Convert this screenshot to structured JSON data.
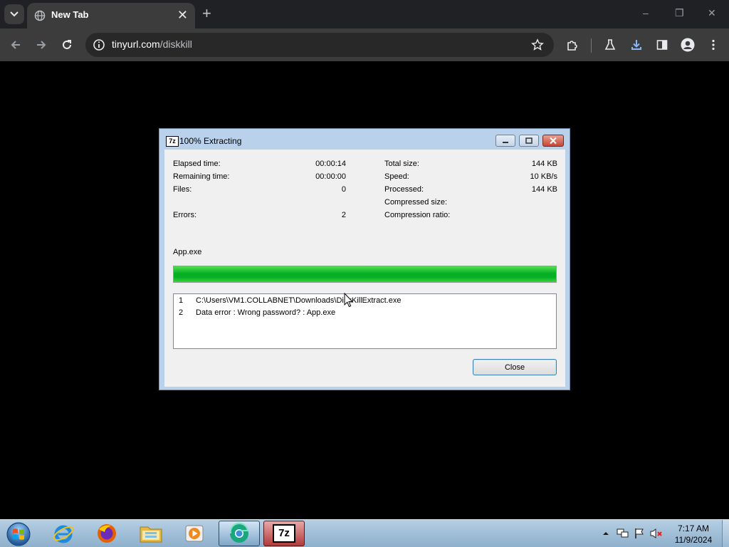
{
  "browser": {
    "tab_title": "New Tab",
    "url_domain": "tinyurl.com",
    "url_path": "/diskkill",
    "tab_close_glyph": "✕",
    "new_tab_glyph": "+",
    "window_controls": [
      "–",
      "❐",
      "✕"
    ]
  },
  "dialog": {
    "title": "100% Extracting",
    "title_icon_text": "7z",
    "stats_left": [
      {
        "label": "Elapsed time:",
        "value": "00:00:14"
      },
      {
        "label": "Remaining time:",
        "value": "00:00:00"
      },
      {
        "label": "Files:",
        "value": "0"
      },
      {
        "label": "Errors:",
        "value": "2"
      }
    ],
    "stats_right": [
      {
        "label": "Total size:",
        "value": "144 KB"
      },
      {
        "label": "Speed:",
        "value": "10 KB/s"
      },
      {
        "label": "Processed:",
        "value": "144 KB"
      },
      {
        "label": "Compressed size:",
        "value": ""
      },
      {
        "label": "Compression ratio:",
        "value": ""
      }
    ],
    "current_file": "App.exe",
    "progress_fraction": 1.0,
    "log": [
      {
        "num": "1",
        "text": "C:\\Users\\VM1.COLLABNET\\Downloads\\DiskKillExtract.exe"
      },
      {
        "num": "2",
        "text": "Data error : Wrong password? : App.exe"
      }
    ],
    "close_label": "Close"
  },
  "taskbar": {
    "apps": [
      "windows-start",
      "internet-explorer",
      "firefox",
      "file-explorer",
      "media-player",
      "chrome",
      "7zip"
    ],
    "app_7zip_text": "7z",
    "clock_time": "7:17 AM",
    "clock_date": "11/9/2024"
  },
  "colors": {
    "progress_green": "#06b025",
    "chrome_dark": "#3c3c3c",
    "dialog_frame": "#b9d1ea"
  }
}
